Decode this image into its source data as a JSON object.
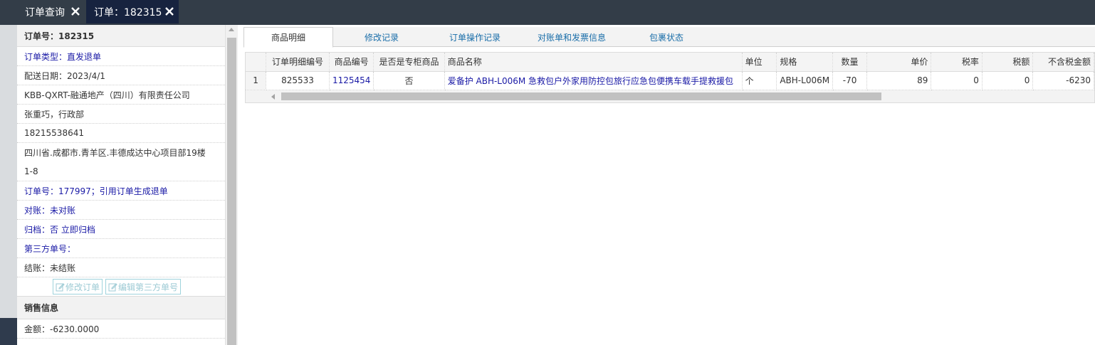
{
  "tabs": [
    {
      "label": "订单查询"
    },
    {
      "label": "订单：182315"
    }
  ],
  "info": {
    "order_no": "订单号：182315",
    "order_type_label": "订单类型：",
    "order_type_value": "直发退单",
    "delivery_date": "配送日期：2023/4/1",
    "company": "KBB-QXRT-融通地产（四川）有限责任公司",
    "contact": "张重巧，行政部",
    "phone": "18215538641",
    "address": "四川省.成都市.青羊区.丰德成达中心项目部19楼",
    "address2": "1-8",
    "ref_order": "订单号：177997；引用订单生成退单",
    "reconcile": "对账：未对账",
    "archive_label": "归档：",
    "archive_value": "否 立即归档",
    "third_party": "第三方单号：",
    "settle": "结账：未结账",
    "btn_edit_order": "修改订单",
    "btn_edit_third": "编辑第三方单号",
    "sales_header": "销售信息",
    "amount": "金额：-6230.0000"
  },
  "detail_tabs": [
    {
      "label": "商品明细"
    },
    {
      "label": "修改记录"
    },
    {
      "label": "订单操作记录"
    },
    {
      "label": "对账单和发票信息"
    },
    {
      "label": "包裹状态"
    }
  ],
  "table": {
    "columns": [
      "订单明细编号",
      "商品编号",
      "是否是专柜商品",
      "商品名称",
      "单位",
      "规格",
      "数量",
      "单价",
      "税率",
      "税额",
      "不含税金额"
    ],
    "rows": [
      {
        "num": "1",
        "detail_id": "825533",
        "product_id": "1125454",
        "counter": "否",
        "name": "爱备护 ABH-L006M 急救包户外家用防控包旅行应急包便携车载手提救援包",
        "unit": "个",
        "spec": "ABH-L006M",
        "qty": "-70",
        "price": "89",
        "tax_rate": "0",
        "tax": "0",
        "net": "-6230"
      }
    ]
  }
}
